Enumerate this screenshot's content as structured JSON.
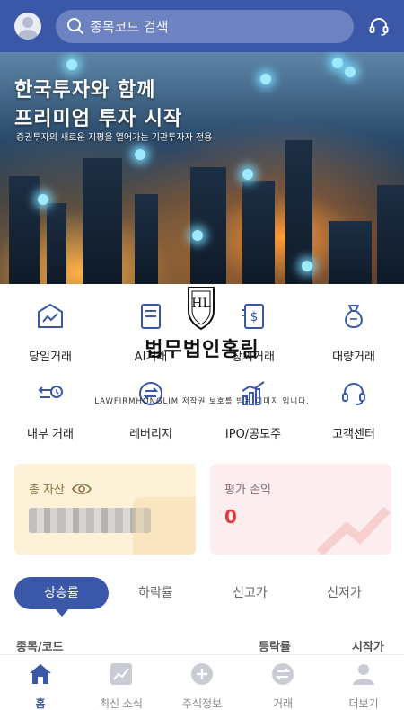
{
  "header": {
    "search_placeholder": "종목코드 검색",
    "icons": [
      "profile-avatar",
      "search-icon",
      "headset-icon"
    ]
  },
  "banner": {
    "title_line1": "한국투자와 함께",
    "title_line2": "프리미엄 투자 시작",
    "subtitle": "증권투자의 새로운 지평을 열어가는 기관투자자 전용"
  },
  "menu": [
    {
      "label": "당일거래",
      "icon": "chart-line-icon"
    },
    {
      "label": "AI거래",
      "icon": "document-icon"
    },
    {
      "label": "장외거래",
      "icon": "dollar-document-icon"
    },
    {
      "label": "대량거래",
      "icon": "money-bag-icon"
    },
    {
      "label": "내부 거래",
      "icon": "transfer-clock-icon"
    },
    {
      "label": "레버리지",
      "icon": "exchange-circle-icon"
    },
    {
      "label": "IPO/공모주",
      "icon": "bar-chart-icon"
    },
    {
      "label": "고객센터",
      "icon": "headset-icon"
    }
  ],
  "watermark": {
    "logo_text": "HL",
    "title": "법무법인홍림",
    "subtitle": "LAWFIRMHONGLIM 저작권 보호를 받는 이미지 입니다."
  },
  "cards": {
    "asset_title": "총 자산",
    "pl_title": "평가 손익",
    "pl_value": "0"
  },
  "tabs": [
    "상승률",
    "하락률",
    "신고가",
    "신저가"
  ],
  "table_header": {
    "col1": "종목/코드",
    "col2": "등락률",
    "col3": "시작가"
  },
  "nav": [
    {
      "label": "홈",
      "icon": "home-icon",
      "active": true
    },
    {
      "label": "최신 소식",
      "icon": "news-chart-icon",
      "active": false
    },
    {
      "label": "주식정보",
      "icon": "plus-circle-icon",
      "active": false
    },
    {
      "label": "거래",
      "icon": "exchange-icon",
      "active": false
    },
    {
      "label": "더보기",
      "icon": "person-icon",
      "active": false
    }
  ],
  "colors": {
    "brand": "#3a57a8",
    "loss_red": "#e23a3a",
    "asset_card": "#fdf1d8",
    "pl_card": "#fceeee"
  }
}
